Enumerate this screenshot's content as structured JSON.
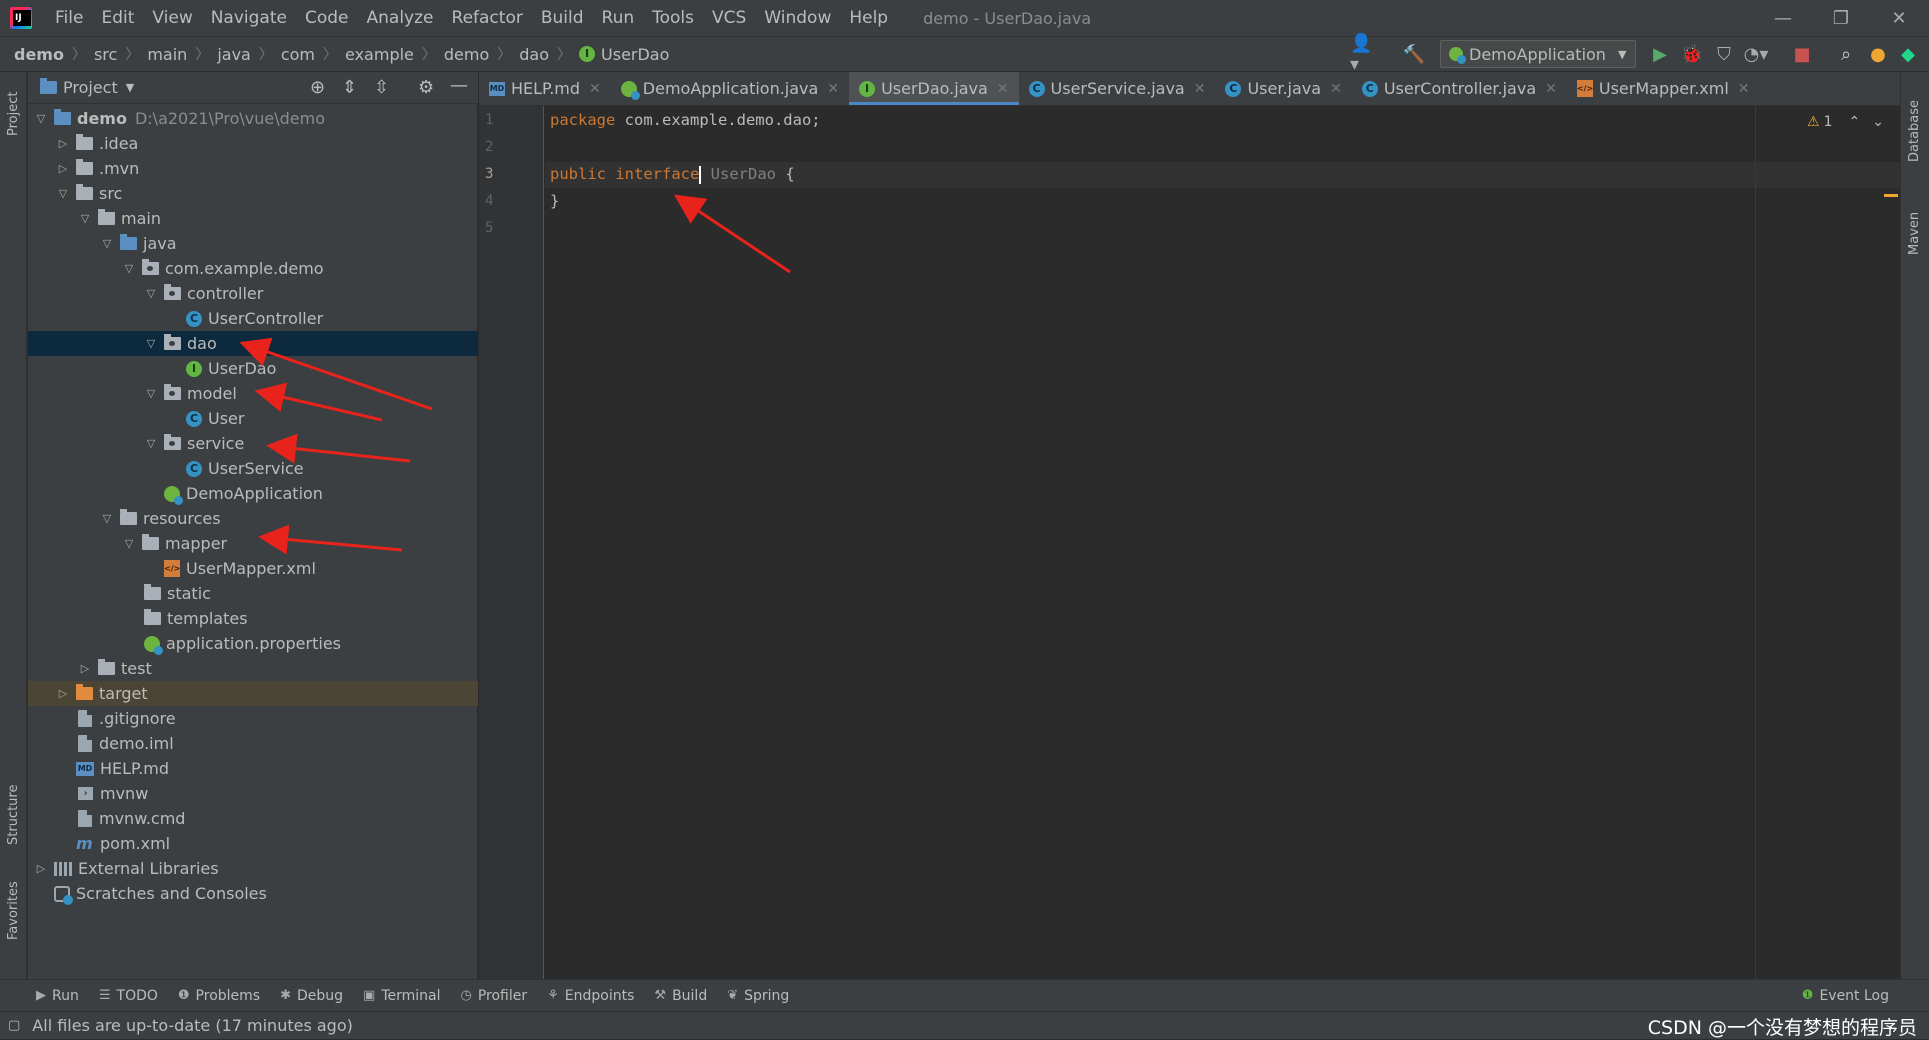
{
  "window": {
    "menu": [
      "File",
      "Edit",
      "View",
      "Navigate",
      "Code",
      "Analyze",
      "Refactor",
      "Build",
      "Run",
      "Tools",
      "VCS",
      "Window",
      "Help"
    ],
    "title": "demo - UserDao.java"
  },
  "breadcrumb": [
    "demo",
    "src",
    "main",
    "java",
    "com",
    "example",
    "demo",
    "dao",
    "UserDao"
  ],
  "run_config": "DemoApplication",
  "project_panel": {
    "title": "Project",
    "tree": {
      "root_name": "demo",
      "root_path": "D:\\a2021\\Pro\\vue\\demo",
      "idea": ".idea",
      "mvn": ".mvn",
      "src": "src",
      "main": "main",
      "java": "java",
      "pkg": "com.example.demo",
      "controller": "controller",
      "usercontroller": "UserController",
      "dao": "dao",
      "userdao": "UserDao",
      "model": "model",
      "user": "User",
      "service": "service",
      "userservice": "UserService",
      "demoapp": "DemoApplication",
      "resources": "resources",
      "mapper": "mapper",
      "usermapper": "UserMapper.xml",
      "static": "static",
      "templates": "templates",
      "appprops": "application.properties",
      "test": "test",
      "target": "target",
      "gitignore": ".gitignore",
      "demoiml": "demo.iml",
      "helpmd": "HELP.md",
      "mvnw": "mvnw",
      "mvnwcmd": "mvnw.cmd",
      "pom": "pom.xml",
      "extlib": "External Libraries",
      "scratches": "Scratches and Consoles"
    }
  },
  "tabs": [
    {
      "label": "HELP.md",
      "icon": "md-icon"
    },
    {
      "label": "DemoApplication.java",
      "icon": "spring-class-icon"
    },
    {
      "label": "UserDao.java",
      "icon": "interface-icon",
      "active": true
    },
    {
      "label": "UserService.java",
      "icon": "class-icon"
    },
    {
      "label": "User.java",
      "icon": "class-icon"
    },
    {
      "label": "UserController.java",
      "icon": "class-icon"
    },
    {
      "label": "UserMapper.xml",
      "icon": "xml-icon"
    }
  ],
  "editor": {
    "line_numbers": [
      "1",
      "2",
      "3",
      "4",
      "5"
    ],
    "line1_kw": "package",
    "line1_rest": " com.example.demo.dao;",
    "line3_kw1": "public",
    "line3_kw2": "interface",
    "line3_name": " UserDao",
    "line3_brace": " {",
    "line4": "}",
    "warnings": "1"
  },
  "side_labels": {
    "project": "Project",
    "structure": "Structure",
    "favorites": "Favorites",
    "database": "Database",
    "maven": "Maven"
  },
  "bottom_tools": [
    "Run",
    "TODO",
    "Problems",
    "Debug",
    "Terminal",
    "Profiler",
    "Endpoints",
    "Build",
    "Spring"
  ],
  "event_log": "Event Log",
  "status_message": "All files are up-to-date (17 minutes ago)",
  "watermark": "CSDN @一个没有梦想的程序员",
  "colors": {
    "keyword": "#cc7832",
    "selection": "#0d293e",
    "arrow": "#e8231c",
    "tab_underline": "#4a88c7"
  }
}
